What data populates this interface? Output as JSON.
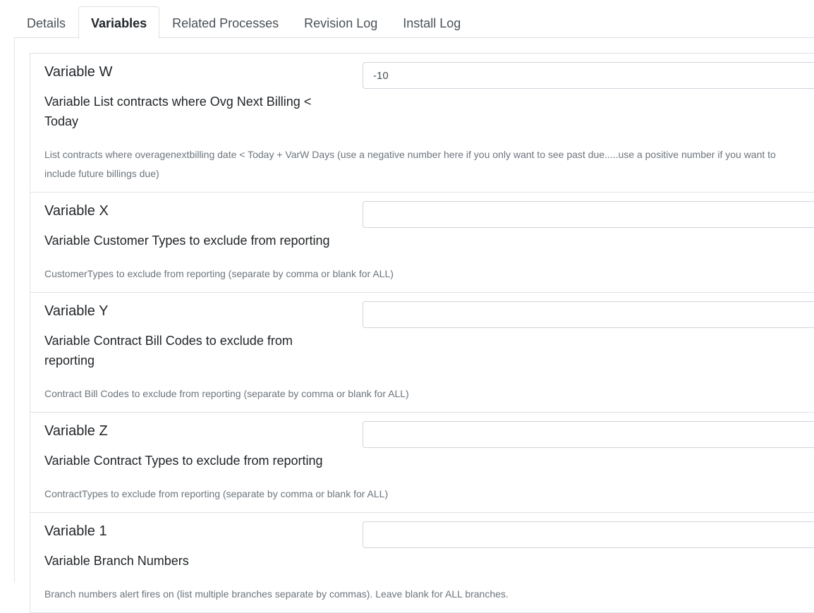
{
  "tabs": [
    {
      "label": "Details",
      "active": false
    },
    {
      "label": "Variables",
      "active": true
    },
    {
      "label": "Related Processes",
      "active": false
    },
    {
      "label": "Revision Log",
      "active": false
    },
    {
      "label": "Install Log",
      "active": false
    }
  ],
  "variables": [
    {
      "name": "Variable W",
      "label": "Variable List contracts where Ovg Next Billing < Today",
      "value": "-10",
      "help": "List contracts where overagenextbilling date < Today + VarW Days (use a negative number here if you only want to see past due.....use a positive number if you want to include future billings due)"
    },
    {
      "name": "Variable X",
      "label": "Variable Customer Types to exclude from reporting",
      "value": "",
      "help": "CustomerTypes to exclude from reporting (separate by comma or blank for ALL)"
    },
    {
      "name": "Variable Y",
      "label": "Variable Contract Bill Codes to exclude from reporting",
      "value": "",
      "help": "Contract Bill Codes to exclude from reporting (separate by comma or blank for ALL)"
    },
    {
      "name": "Variable Z",
      "label": "Variable Contract Types to exclude from reporting",
      "value": "",
      "help": "ContractTypes to exclude from reporting (separate by comma or blank for ALL)"
    },
    {
      "name": "Variable 1",
      "label": "Variable Branch Numbers",
      "value": "",
      "help": "Branch numbers alert fires on (list multiple branches separate by commas). Leave blank for ALL branches."
    }
  ]
}
